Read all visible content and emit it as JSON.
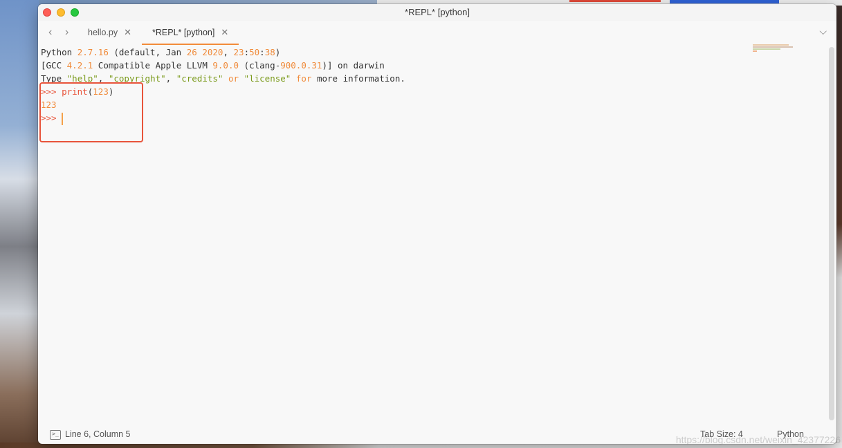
{
  "window": {
    "title": "*REPL* [python]"
  },
  "tabs": [
    {
      "label": "hello.py",
      "active": false
    },
    {
      "label": "*REPL* [python]",
      "active": true
    }
  ],
  "nav": {
    "back": "‹",
    "forward": "›"
  },
  "editor": {
    "line1": {
      "a": "Python ",
      "b": "2.7.16",
      "c": " (default, Jan ",
      "d": "26",
      "e": " ",
      "f": "2020",
      "g": ", ",
      "h": "23",
      "i": ":",
      "j": "50",
      "k": ":",
      "l": "38",
      "m": ")"
    },
    "line2": {
      "a": "[GCC ",
      "b": "4.2.1",
      "c": " Compatible Apple LLVM ",
      "d": "9.0.0",
      "e": " (clang-",
      "f": "900.0.31",
      "g": ")] on darwin"
    },
    "line3": {
      "a": "Type ",
      "b": "\"help\"",
      "c": ", ",
      "d": "\"copyright\"",
      "e": ", ",
      "f": "\"credits\"",
      "g": " ",
      "h": "or",
      "i": " ",
      "j": "\"license\"",
      "k": " ",
      "l": "for",
      "m": " more information."
    },
    "line4": {
      "prompt": ">>> ",
      "fn": "print",
      "open": "(",
      "arg": "123",
      "close": ")"
    },
    "line5": {
      "output": "123"
    },
    "line6": {
      "prompt": ">>> "
    }
  },
  "status": {
    "position": "Line 6, Column 5",
    "tab_size": "Tab Size: 4",
    "syntax": "Python"
  },
  "watermark": "https://blog.csdn.net/weixin_42377226",
  "colors": {
    "accent": "#f28b3a",
    "prompt": "#e8543b",
    "string": "#7a9a1a",
    "highlight_box": "#e8543b"
  }
}
